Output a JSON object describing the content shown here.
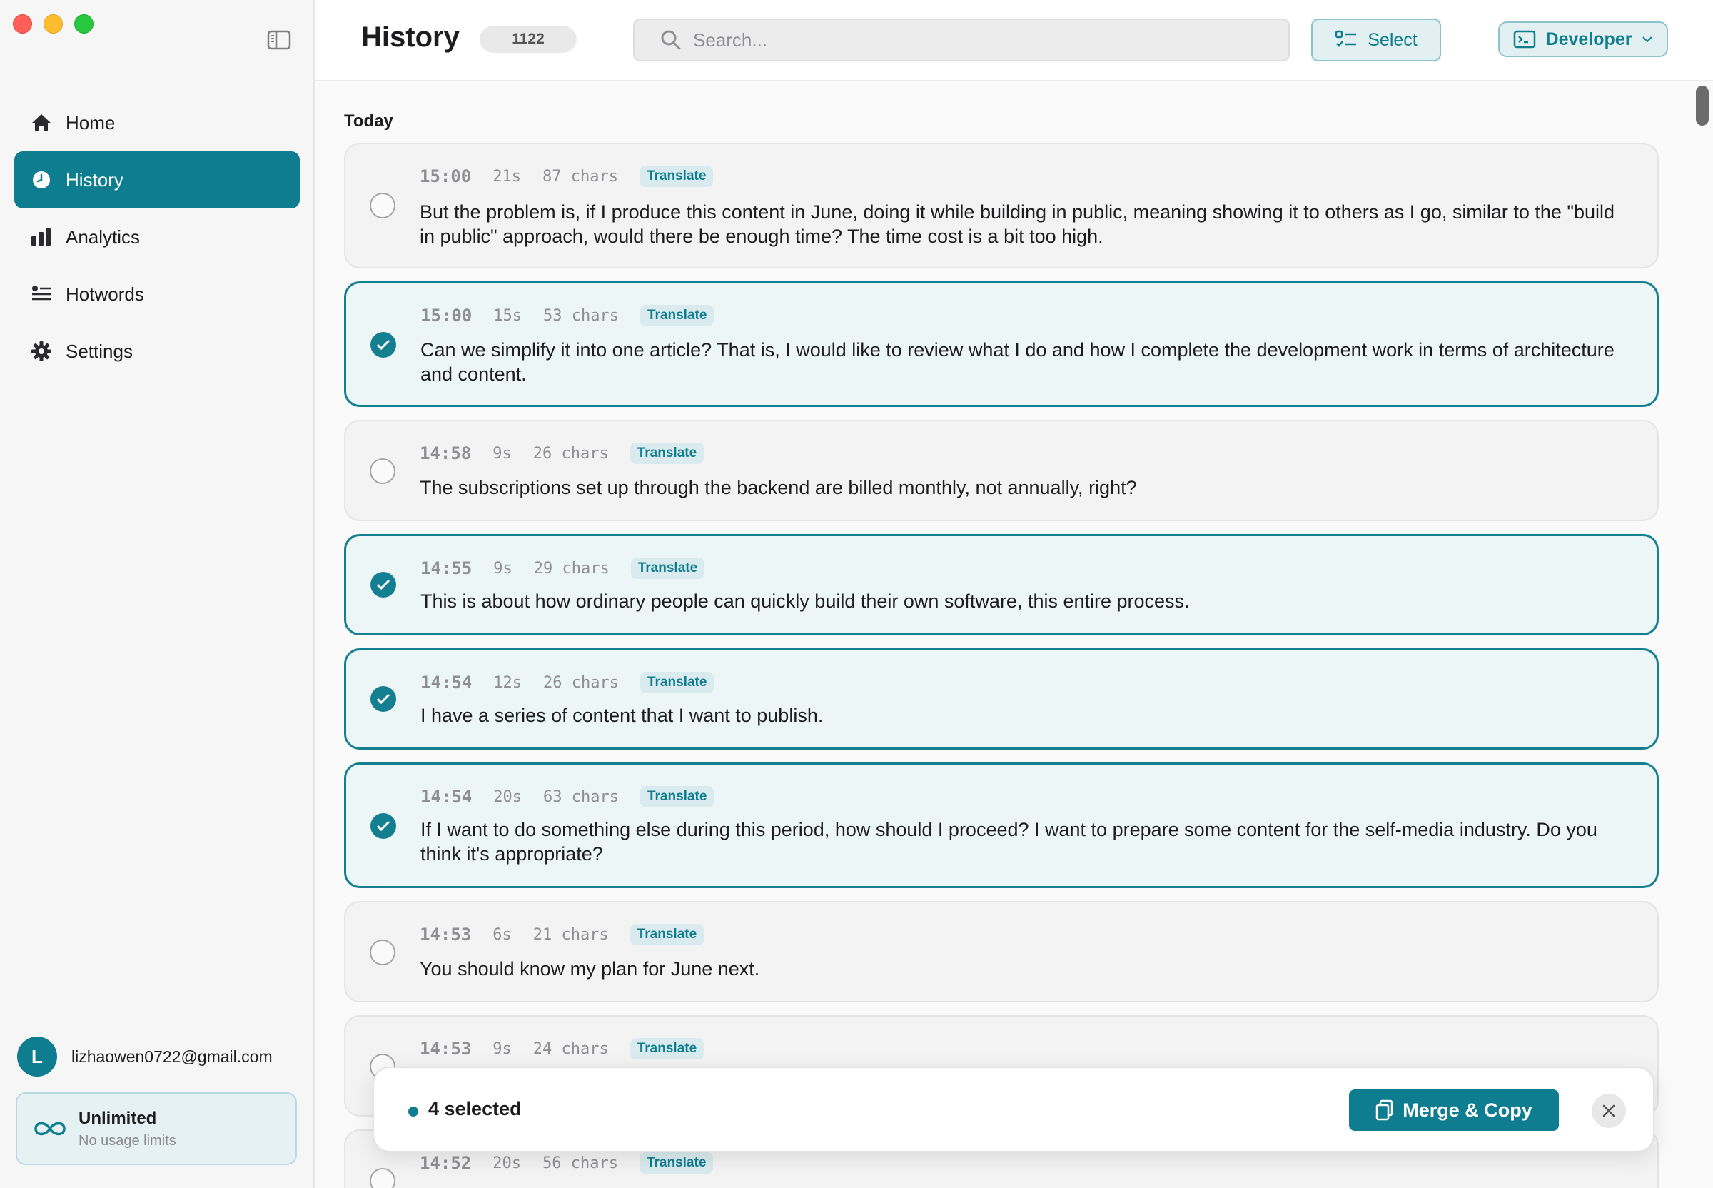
{
  "sidebar": {
    "items": [
      {
        "label": "Home",
        "icon": "home-icon"
      },
      {
        "label": "History",
        "icon": "clock-icon"
      },
      {
        "label": "Analytics",
        "icon": "bar-chart-icon"
      },
      {
        "label": "Hotwords",
        "icon": "hotwords-list-icon"
      },
      {
        "label": "Settings",
        "icon": "gear-icon"
      }
    ],
    "active_index": 1,
    "account": {
      "initial": "L",
      "email": "lizhaowen0722@gmail.com"
    },
    "plan": {
      "title": "Unlimited",
      "subtitle": "No usage limits"
    }
  },
  "header": {
    "title": "History",
    "count": "1122",
    "search_placeholder": "Search...",
    "select_label": "Select",
    "mode_label": "Developer"
  },
  "colors": {
    "accent": "#0e7d8f",
    "selected_border": "#137f90"
  },
  "section": "Today",
  "entries": [
    {
      "time": "15:00",
      "duration": "21s",
      "chars": "87 chars",
      "tag": "Translate",
      "selected": false,
      "text": "But the problem is, if I produce this content in June, doing it while building in public, meaning showing it to others as I go, similar to the \"build in public\" approach, would there be enough time? The time cost is a bit too high."
    },
    {
      "time": "15:00",
      "duration": "15s",
      "chars": "53 chars",
      "tag": "Translate",
      "selected": true,
      "text": "Can we simplify it into one article? That is, I would like to review what I do and how I complete the development work in terms of architecture and content."
    },
    {
      "time": "14:58",
      "duration": "9s",
      "chars": "26 chars",
      "tag": "Translate",
      "selected": false,
      "text": "The subscriptions set up through the backend are billed monthly, not annually, right?"
    },
    {
      "time": "14:55",
      "duration": "9s",
      "chars": "29 chars",
      "tag": "Translate",
      "selected": true,
      "text": "This is about how ordinary people can quickly build their own software, this entire process."
    },
    {
      "time": "14:54",
      "duration": "12s",
      "chars": "26 chars",
      "tag": "Translate",
      "selected": true,
      "text": "I have a series of content that I want to publish."
    },
    {
      "time": "14:54",
      "duration": "20s",
      "chars": "63 chars",
      "tag": "Translate",
      "selected": true,
      "text": "If I want to do something else during this period, how should I proceed? I want to prepare some content for the self-media industry. Do you think it's appropriate?"
    },
    {
      "time": "14:53",
      "duration": "6s",
      "chars": "21 chars",
      "tag": "Translate",
      "selected": false,
      "text": "You should know my plan for June next."
    },
    {
      "time": "14:53",
      "duration": "9s",
      "chars": "24 chars",
      "tag": "Translate",
      "selected": false,
      "text": ""
    },
    {
      "time": "14:52",
      "duration": "20s",
      "chars": "56 chars",
      "tag": "Translate",
      "selected": false,
      "text": ""
    }
  ],
  "selection_bar": {
    "count_label": "4 selected",
    "merge_label": "Merge & Copy"
  }
}
